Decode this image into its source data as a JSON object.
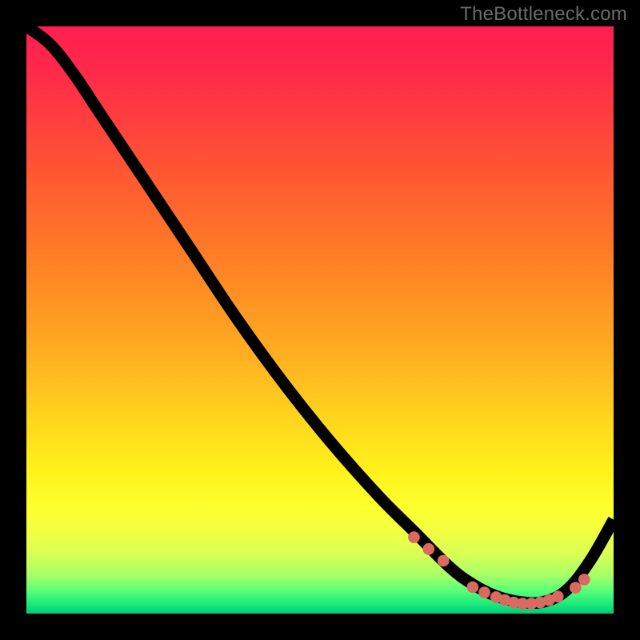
{
  "watermark": "TheBottleneck.com",
  "chart_data": {
    "type": "line",
    "title": "",
    "xlabel": "",
    "ylabel": "",
    "xlim": [
      0,
      100
    ],
    "ylim": [
      0,
      100
    ],
    "grid": false,
    "legend": false,
    "series": [
      {
        "name": "curve",
        "x": [
          0,
          4,
          8,
          12,
          16,
          20,
          28,
          36,
          44,
          52,
          60,
          66,
          72,
          76,
          80,
          84,
          88,
          92,
          96,
          100
        ],
        "y": [
          100,
          97,
          92,
          86,
          80,
          74,
          62,
          50,
          39,
          29,
          20,
          14,
          8,
          5,
          3,
          2,
          2,
          4,
          9,
          16
        ],
        "color": "#000000"
      }
    ],
    "markers": {
      "name": "dots",
      "color": "#d96a62",
      "x": [
        66,
        68.5,
        71,
        76,
        78,
        80,
        81.5,
        83,
        84.5,
        86,
        87.5,
        89,
        90.5,
        93.5,
        95
      ],
      "y": [
        13,
        11,
        9,
        4.5,
        3.6,
        2.8,
        2.3,
        1.9,
        1.7,
        1.7,
        1.9,
        2.3,
        2.9,
        4.4,
        5.8
      ]
    }
  }
}
